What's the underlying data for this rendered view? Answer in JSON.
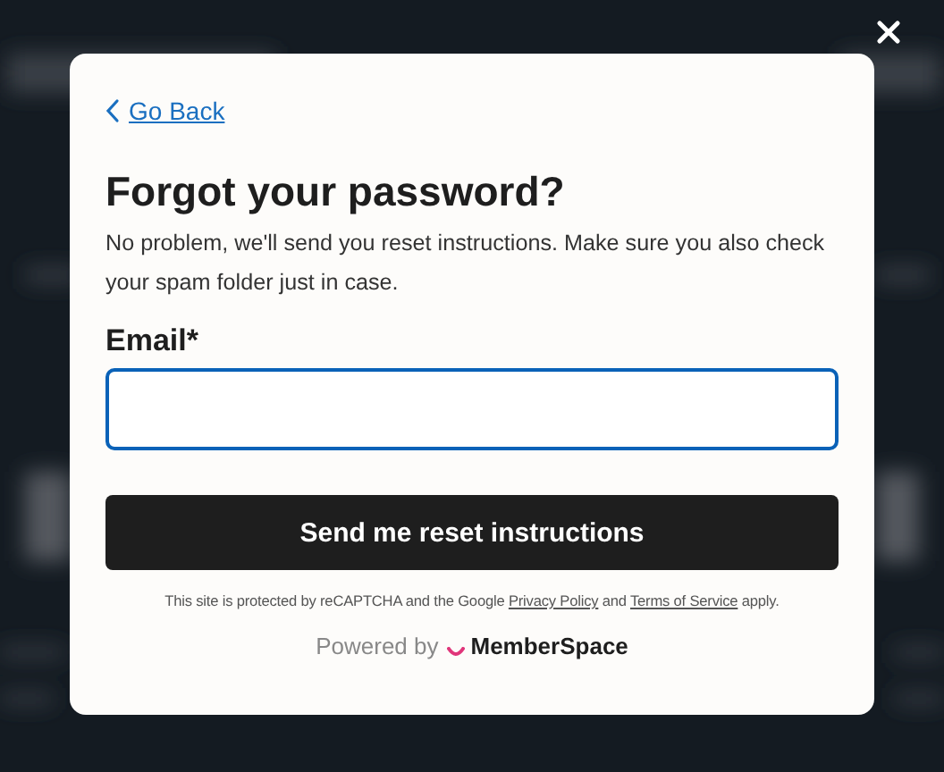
{
  "modal": {
    "back_link": "Go Back",
    "title": "Forgot your password?",
    "description": "No problem, we'll send you reset instructions. Make sure you also check your spam folder just in case.",
    "email_field": {
      "label": "Email*"
    },
    "submit_button": "Send me reset instructions",
    "recaptcha_notice": {
      "before": "This site is protected by reCAPTCHA and the Google",
      "privacy_link": "Privacy Policy",
      "middle": "and",
      "terms_link": "Terms of Service",
      "after": "apply."
    },
    "powered_by": {
      "label": "Powered by",
      "brand": "MemberSpace"
    }
  }
}
